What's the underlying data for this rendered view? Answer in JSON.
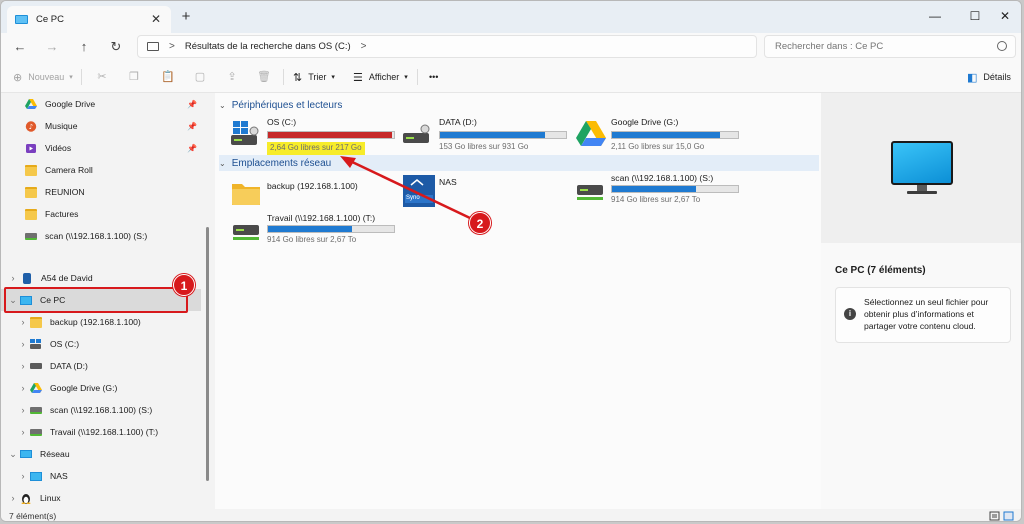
{
  "window": {
    "tab_title": "Ce PC",
    "tab_close": "✕",
    "tab_add": "+",
    "minimize": "—",
    "maximize": "☐",
    "close": "✕"
  },
  "nav": {
    "back": "←",
    "forward": "→",
    "up": "↑",
    "refresh": "↻",
    "breadcrumb_sep": ">",
    "address": "Résultats de la recherche dans OS (C:)",
    "address_chevron": ">",
    "search_placeholder": "Rechercher dans : Ce PC"
  },
  "toolbar": {
    "new_label": "Nouveau",
    "sort_label": "Trier",
    "view_label": "Afficher",
    "more_label": "•••",
    "details_label": "Détails"
  },
  "sidebar": {
    "items": [
      {
        "label": "Google Drive",
        "pinned": true,
        "icon": "google-drive-icon"
      },
      {
        "label": "Musique",
        "pinned": true,
        "icon": "music-icon"
      },
      {
        "label": "Vidéos",
        "pinned": true,
        "icon": "video-icon"
      },
      {
        "label": "Camera Roll",
        "pinned": false,
        "icon": "folder-icon"
      },
      {
        "label": "REUNION",
        "pinned": false,
        "icon": "folder-icon"
      },
      {
        "label": "Factures",
        "pinned": false,
        "icon": "folder-icon"
      },
      {
        "label": "scan (\\\\192.168.1.100) (S:)",
        "pinned": false,
        "icon": "network-drive-icon"
      },
      {
        "label": "A54 de David",
        "pinned": false,
        "icon": "phone-icon"
      },
      {
        "label": "Ce PC",
        "pinned": false,
        "icon": "pc-icon"
      },
      {
        "label": "backup (192.168.1.100)",
        "pinned": false,
        "icon": "folder-icon"
      },
      {
        "label": "OS (C:)",
        "pinned": false,
        "icon": "os-drive-icon"
      },
      {
        "label": "DATA (D:)",
        "pinned": false,
        "icon": "hdd-icon"
      },
      {
        "label": "Google Drive (G:)",
        "pinned": false,
        "icon": "google-drive-icon"
      },
      {
        "label": "scan (\\\\192.168.1.100) (S:)",
        "pinned": false,
        "icon": "network-drive-icon"
      },
      {
        "label": "Travail (\\\\192.168.1.100) (T:)",
        "pinned": false,
        "icon": "network-drive-icon"
      },
      {
        "label": "Réseau",
        "pinned": false,
        "icon": "network-icon"
      },
      {
        "label": "NAS",
        "pinned": false,
        "icon": "pc-icon"
      },
      {
        "label": "Linux",
        "pinned": false,
        "icon": "linux-icon"
      }
    ]
  },
  "content": {
    "group_devices": "Périphériques et lecteurs",
    "group_network": "Emplacements réseau",
    "drives": [
      {
        "name": "OS (C:)",
        "free": "2,64 Go libres sur 217 Go",
        "used_fraction": 0.988,
        "full": true
      },
      {
        "name": "DATA (D:)",
        "free": "153 Go libres sur 931 Go",
        "used_fraction": 0.836,
        "full": false
      },
      {
        "name": "Google Drive (G:)",
        "free": "2,11 Go libres sur 15,0 Go",
        "used_fraction": 0.859,
        "full": false
      }
    ],
    "network": [
      {
        "name": "backup (192.168.1.100)"
      },
      {
        "name": "NAS"
      },
      {
        "name": "scan (\\\\192.168.1.100) (S:)",
        "free": "914 Go libres sur 2,67 To",
        "used_fraction": 0.666
      },
      {
        "name": "Travail (\\\\192.168.1.100) (T:)",
        "free": "914 Go libres sur 2,67 To",
        "used_fraction": 0.666
      }
    ],
    "nas_logo_text": "Syno"
  },
  "details": {
    "title": "Ce PC (7 éléments)",
    "info_text": "Sélectionnez un seul fichier pour obtenir plus d’informations et partager votre contenu cloud.",
    "info_glyph": "i"
  },
  "status": {
    "count": "7 élément(s)"
  },
  "annotations": {
    "badge1": "1",
    "badge2": "2"
  },
  "colors": {
    "accent": "#1f7ad1",
    "drive_full": "#c62828",
    "annotation": "#d7191c",
    "highlight": "#f7ec2a"
  }
}
